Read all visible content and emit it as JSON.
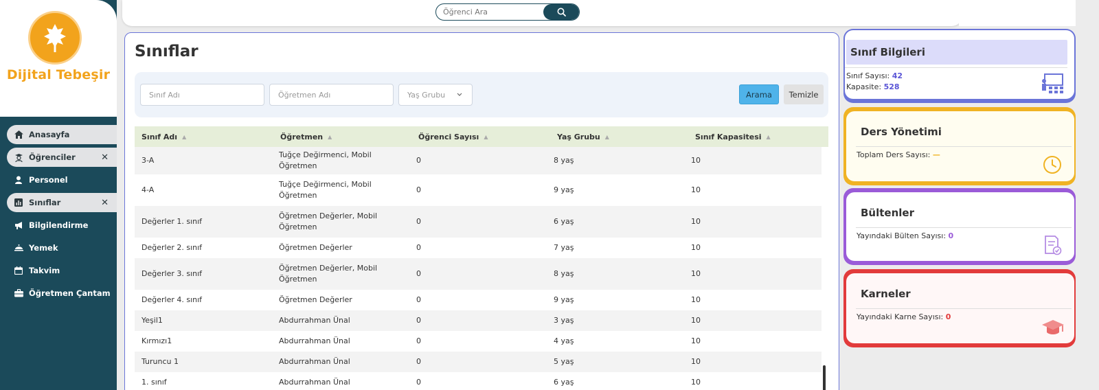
{
  "brand": {
    "name": "Dijital Tebeşir"
  },
  "search": {
    "placeholder": "Öğrenci Ara"
  },
  "sidebar": {
    "items": [
      {
        "label": "Anasayfa",
        "icon": "home-icon"
      },
      {
        "label": "Öğrenciler",
        "icon": "student-icon"
      },
      {
        "label": "Personel",
        "icon": "person-icon"
      },
      {
        "label": "Sınıflar",
        "icon": "chart-icon"
      },
      {
        "label": "Bilgilendirme",
        "icon": "megaphone-icon"
      },
      {
        "label": "Yemek",
        "icon": "dish-icon"
      },
      {
        "label": "Takvim",
        "icon": "calendar-icon"
      },
      {
        "label": "Öğretmen Çantam",
        "icon": "briefcase-icon"
      }
    ]
  },
  "page": {
    "title": "Sınıflar"
  },
  "filter": {
    "class_name_placeholder": "Sınıf Adı",
    "teacher_placeholder": "Öğretmen Adı",
    "age_group_placeholder": "Yaş Grubu",
    "search_button": "Arama",
    "clear_button": "Temizle"
  },
  "table": {
    "headers": [
      "Sınıf Adı",
      "Öğretmen",
      "Öğrenci Sayısı",
      "Yaş Grubu",
      "Sınıf Kapasitesi"
    ],
    "rows": [
      {
        "name": "3-A",
        "teacher": "Tuğçe Değirmenci, Mobil Öğretmen",
        "students": "0",
        "age": "8 yaş",
        "capacity": "10"
      },
      {
        "name": "4-A",
        "teacher": "Tuğçe Değirmenci, Mobil Öğretmen",
        "students": "0",
        "age": "9 yaş",
        "capacity": "10"
      },
      {
        "name": "Değerler 1. sınıf",
        "teacher": "Öğretmen Değerler, Mobil Öğretmen",
        "students": "0",
        "age": "6 yaş",
        "capacity": "10"
      },
      {
        "name": "Değerler 2. sınıf",
        "teacher": "Öğretmen Değerler",
        "students": "0",
        "age": "7 yaş",
        "capacity": "10"
      },
      {
        "name": "Değerler 3. sınıf",
        "teacher": "Öğretmen Değerler, Mobil Öğretmen",
        "students": "0",
        "age": "8 yaş",
        "capacity": "10"
      },
      {
        "name": "Değerler 4. sınıf",
        "teacher": "Öğretmen Değerler",
        "students": "0",
        "age": "9 yaş",
        "capacity": "10"
      },
      {
        "name": "Yeşil1",
        "teacher": "Abdurrahman Ünal",
        "students": "0",
        "age": "3 yaş",
        "capacity": "10"
      },
      {
        "name": "Kırmızı1",
        "teacher": "Abdurrahman Ünal",
        "students": "0",
        "age": "4 yaş",
        "capacity": "10"
      },
      {
        "name": "Turuncu 1",
        "teacher": "Abdurrahman Ünal",
        "students": "0",
        "age": "5 yaş",
        "capacity": "10"
      },
      {
        "name": "1. sınıf",
        "teacher": "Abdurrahman Ünal",
        "students": "0",
        "age": "6 yaş",
        "capacity": "10"
      }
    ]
  },
  "cards": {
    "class_info": {
      "title": "Sınıf Bilgileri",
      "count_label": "Sınıf Sayısı:",
      "count_value": "42",
      "capacity_label": "Kapasite:",
      "capacity_value": "528"
    },
    "lessons": {
      "title": "Ders Yönetimi",
      "label": "Toplam Ders Sayısı:",
      "value": "—"
    },
    "bulletins": {
      "title": "Bültenler",
      "label": "Yayındaki Bülten Sayısı:",
      "value": "0"
    },
    "report_cards": {
      "title": "Karneler",
      "label": "Yayındaki Karne Sayısı:",
      "value": "0"
    }
  },
  "colors": {
    "sidebar": "#1b4a5a",
    "brand": "#f2a31c",
    "accent_blue": "#4fb3ea",
    "purple": "#6a74d8",
    "yellow": "#f0b323",
    "violet": "#9a5bd8",
    "red": "#e23b3b"
  }
}
